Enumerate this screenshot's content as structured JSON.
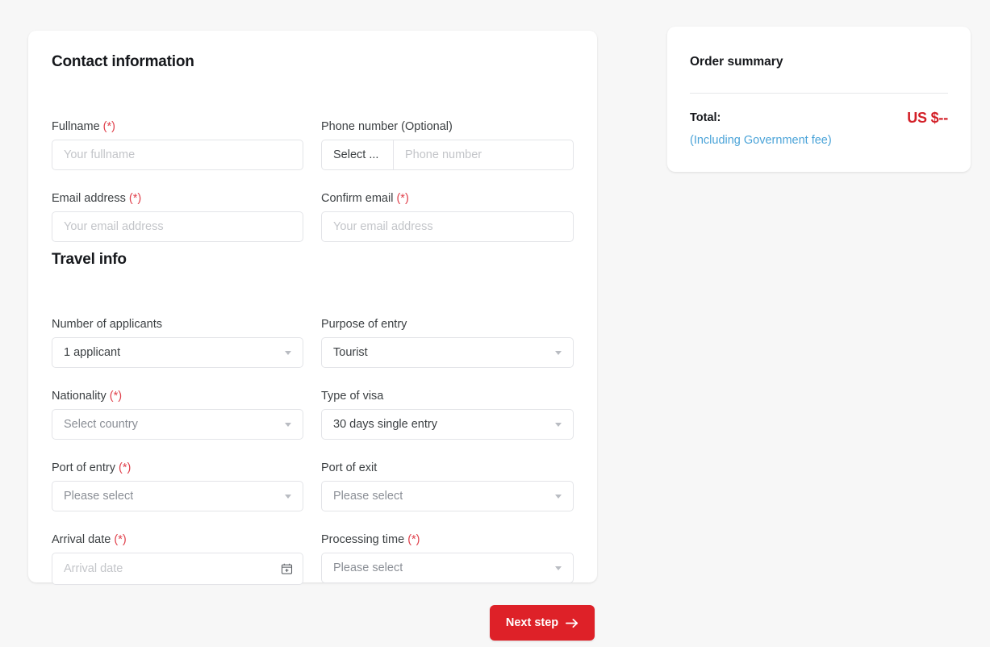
{
  "form": {
    "sections": [
      {
        "title": "Contact information"
      },
      {
        "title": "Travel info"
      }
    ],
    "contact": {
      "fullname": {
        "label": "Fullname",
        "required_mark": "(*)",
        "placeholder": "Your fullname",
        "value": ""
      },
      "phone": {
        "label": "Phone number (Optional)",
        "prefix_value": "Select ...",
        "placeholder": "Phone number",
        "value": ""
      },
      "email": {
        "label": "Email address",
        "required_mark": "(*)",
        "placeholder": "Your email address",
        "value": ""
      },
      "confirm_email": {
        "label": "Confirm email",
        "required_mark": "(*)",
        "placeholder": "Your email address",
        "value": ""
      }
    },
    "travel": {
      "applicants": {
        "label": "Number of applicants",
        "required_mark": "",
        "value": "1 applicant"
      },
      "purpose": {
        "label": "Purpose of entry",
        "required_mark": "",
        "value": "Tourist"
      },
      "nationality": {
        "label": "Nationality",
        "required_mark": "(*)",
        "value": "Select country"
      },
      "visa_type": {
        "label": "Type of visa",
        "required_mark": "",
        "value": "30 days single entry"
      },
      "port_entry": {
        "label": "Port of entry",
        "required_mark": "(*)",
        "value": "Please select"
      },
      "port_exit": {
        "label": "Port of exit",
        "required_mark": "",
        "value": "Please select"
      },
      "arrival_date": {
        "label": "Arrival date",
        "required_mark": "(*)",
        "placeholder": "Arrival date",
        "value": ""
      },
      "processing_time": {
        "label": "Processing time",
        "required_mark": "(*)",
        "value": "Please select"
      }
    }
  },
  "summary": {
    "title": "Order summary",
    "total_label": "Total:",
    "total_value": "US $--",
    "note": "(Including Government fee)",
    "total_color": "#d32028",
    "note_color": "#4aa3d8"
  },
  "actions": {
    "next_step": "Next step"
  }
}
